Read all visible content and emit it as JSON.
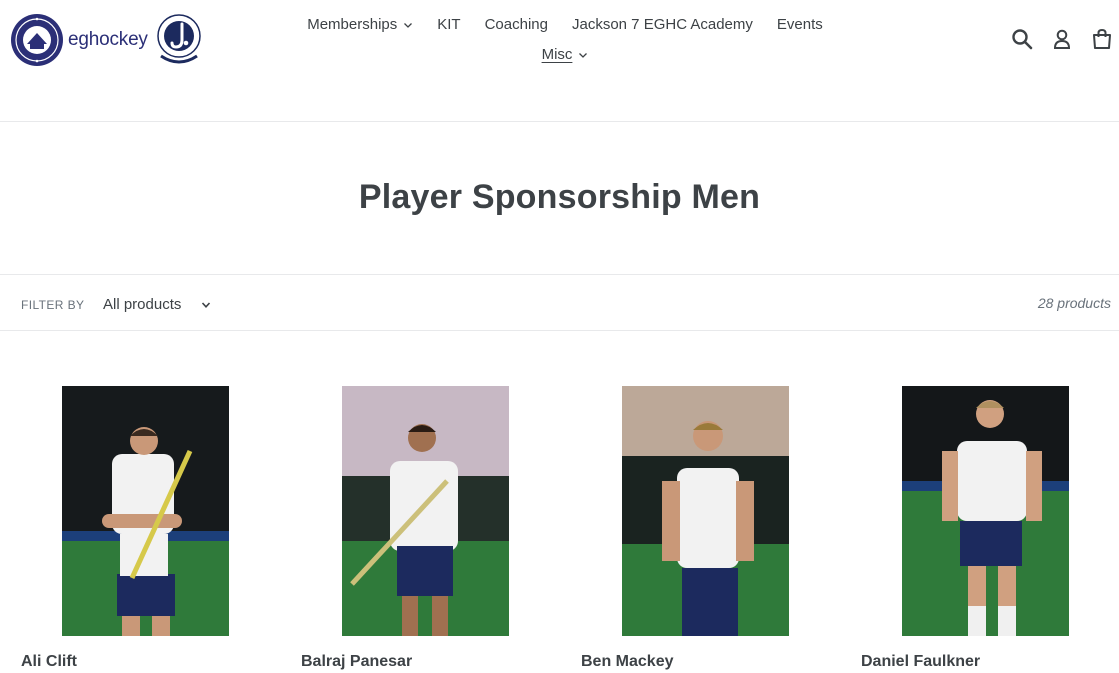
{
  "header": {
    "logo_text": "eghockey",
    "nav": [
      {
        "label": "Memberships",
        "has_dropdown": true
      },
      {
        "label": "KIT",
        "has_dropdown": false
      },
      {
        "label": "Coaching",
        "has_dropdown": false
      },
      {
        "label": "Jackson 7 EGHC Academy",
        "has_dropdown": false
      },
      {
        "label": "Events",
        "has_dropdown": false
      }
    ],
    "nav_second": {
      "label": "Misc",
      "has_dropdown": true,
      "active": true
    },
    "icons": [
      "search-icon",
      "account-icon",
      "cart-icon"
    ]
  },
  "collection": {
    "title": "Player Sponsorship Men",
    "filter_label": "Filter by",
    "filter_value": "All products",
    "product_count": "28 products"
  },
  "products": [
    {
      "name": "Ali Clift"
    },
    {
      "name": "Balraj Panesar"
    },
    {
      "name": "Ben Mackey"
    },
    {
      "name": "Daniel Faulkner"
    }
  ],
  "colors": {
    "text": "#3d4246",
    "muted": "#69727b",
    "border": "#e8e9eb",
    "brand_navy": "#2b2f77",
    "pitch_green": "#2f7a3a",
    "pitch_blue": "#1c3f7a"
  }
}
